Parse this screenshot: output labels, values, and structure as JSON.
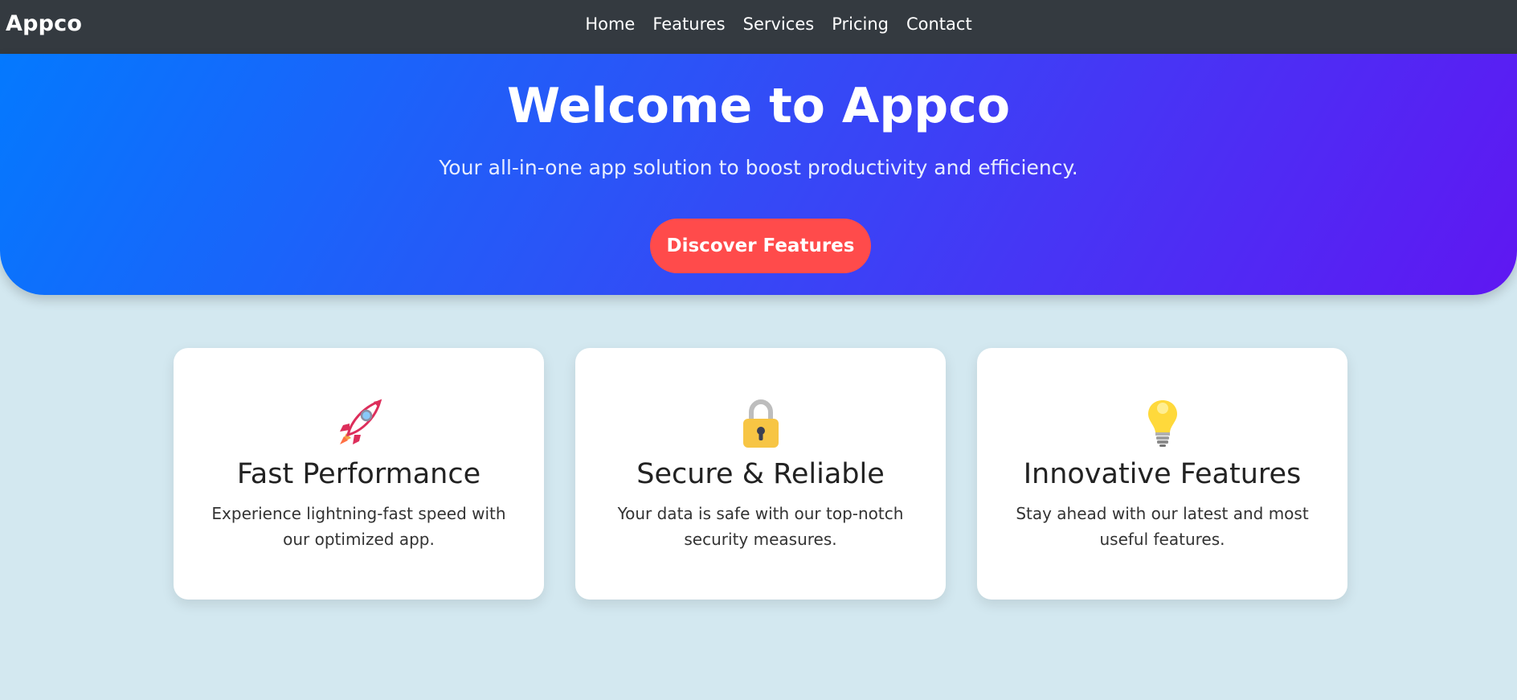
{
  "navbar": {
    "brand": "Appco",
    "links": [
      {
        "label": "Home"
      },
      {
        "label": "Features"
      },
      {
        "label": "Services"
      },
      {
        "label": "Pricing"
      },
      {
        "label": "Contact"
      }
    ]
  },
  "hero": {
    "title": "Welcome to Appco",
    "subtitle": "Your all-in-one app solution to boost productivity and efficiency.",
    "cta_label": "Discover Features"
  },
  "features": [
    {
      "icon": "rocket-icon",
      "title": "Fast Performance",
      "text": "Experience lightning-fast speed with our optimized app."
    },
    {
      "icon": "lock-icon",
      "title": "Secure & Reliable",
      "text": "Your data is safe with our top-notch security measures."
    },
    {
      "icon": "lightbulb-icon",
      "title": "Innovative Features",
      "text": "Stay ahead with our latest and most useful features."
    }
  ],
  "colors": {
    "navbar_bg": "#343a40",
    "hero_gradient_start": "#0479fe",
    "hero_gradient_end": "#5f17f2",
    "cta_bg": "#ff4b4b",
    "page_bg": "#d3e8f0",
    "card_bg": "#ffffff"
  }
}
